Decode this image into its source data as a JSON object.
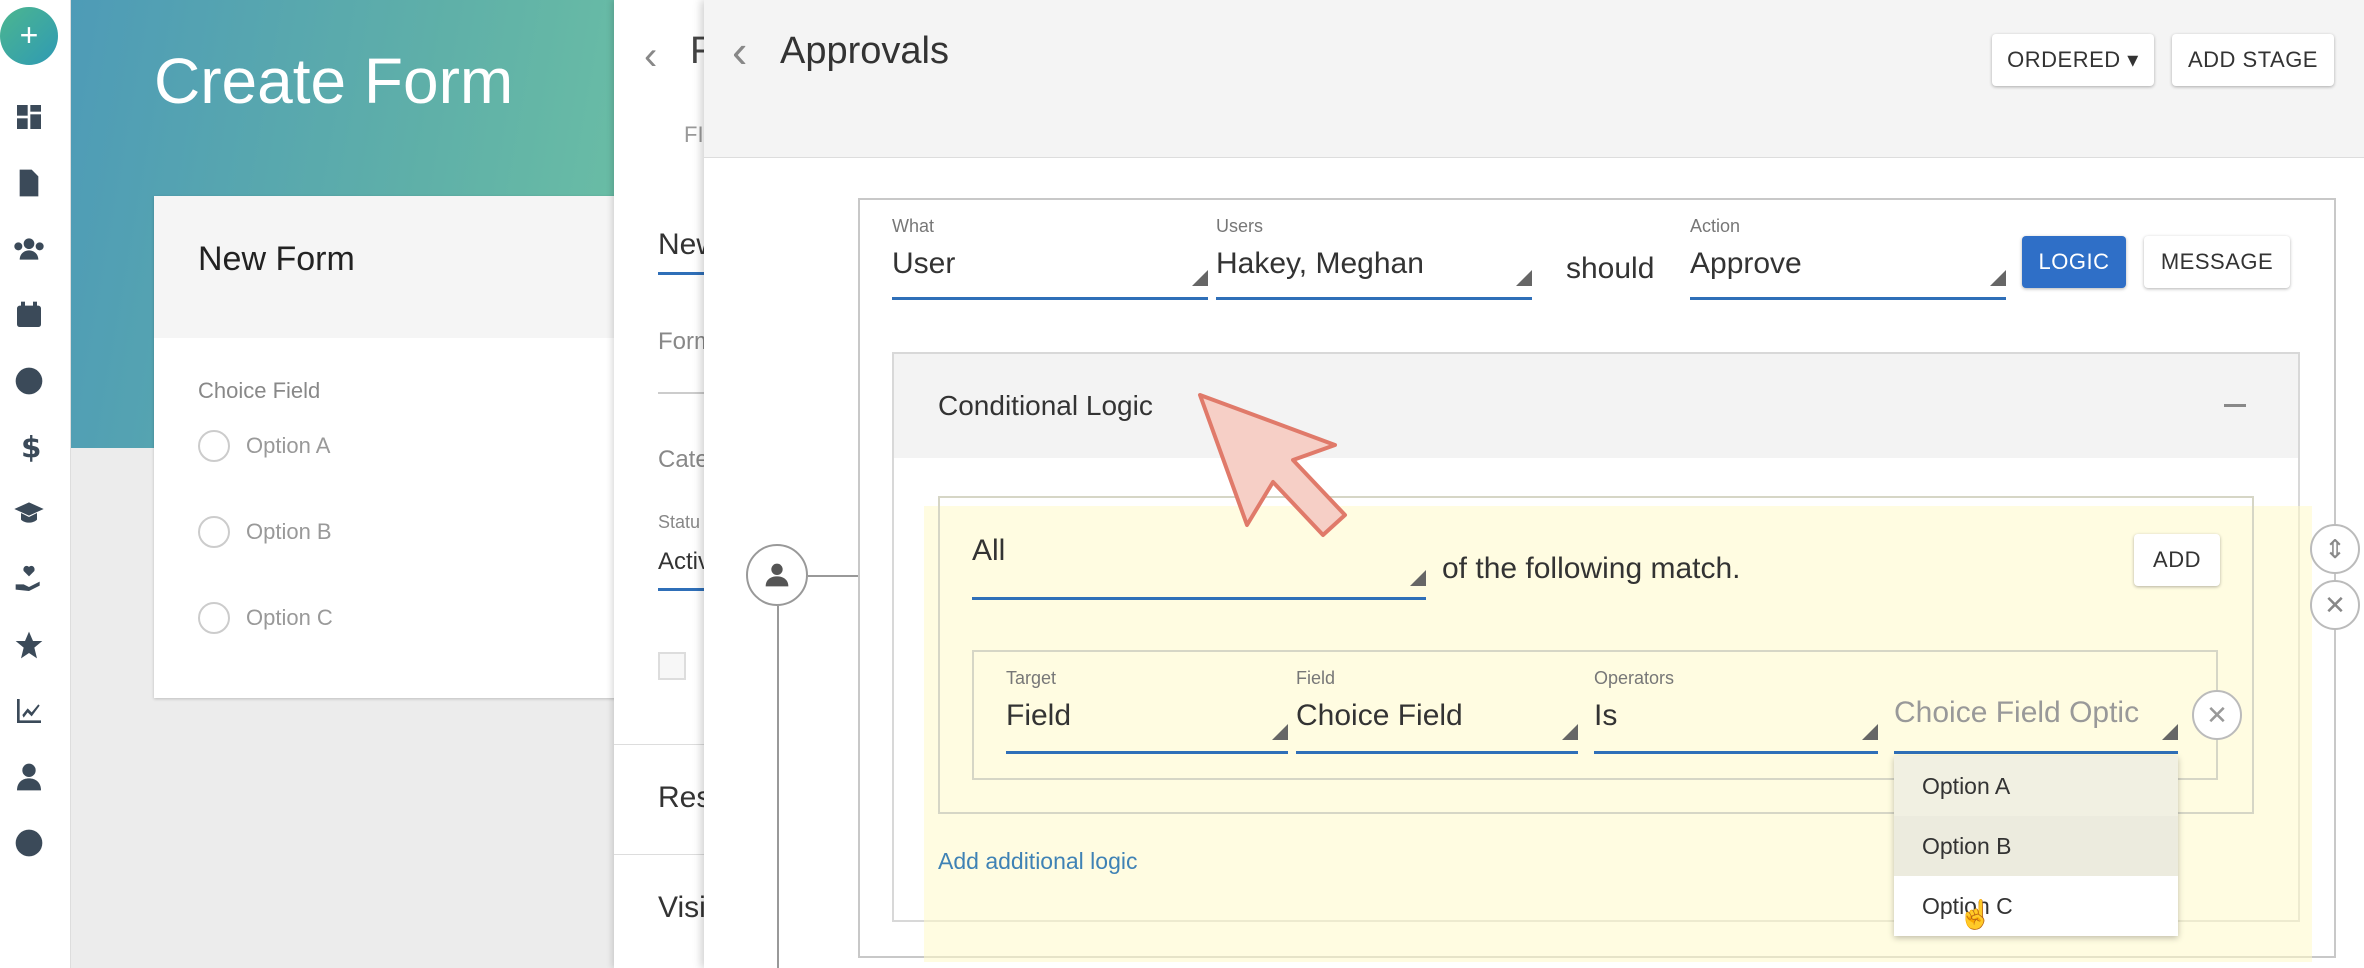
{
  "rail": {
    "fab_label": "+",
    "icons": [
      "dashboard-icon",
      "document-icon",
      "users-icon",
      "calendar-icon",
      "globe-icon",
      "dollar-icon",
      "graduation-icon",
      "hand-heart-icon",
      "star-icon",
      "chart-icon",
      "person-icon",
      "compass-icon"
    ]
  },
  "create_form": {
    "title": "Create Form",
    "card_title": "New Form",
    "field_label": "Choice Field",
    "options": [
      "Option A",
      "Option B",
      "Option C"
    ]
  },
  "middle_panel": {
    "title_fragment": "F",
    "tab_fragment": "FI",
    "heading_fragment": "New",
    "label_form_fragment": "Form",
    "label_category_fragment": "Cate",
    "label_status_fragment": "Statu",
    "status_value_fragment": "Activ",
    "section_res_fragment": "Res",
    "section_visi_fragment": "Visi"
  },
  "approvals": {
    "title": "Approvals",
    "ordered_label": "ORDERED ▾",
    "add_stage_label": "ADD STAGE",
    "what_caption": "What",
    "what_value": "User",
    "users_caption": "Users",
    "users_value": "Hakey, Meghan",
    "should_text": "should",
    "action_caption": "Action",
    "action_value": "Approve",
    "logic_label": "LOGIC",
    "message_label": "MESSAGE",
    "conditional_title": "Conditional Logic",
    "all_value": "All",
    "match_text": "of the following match.",
    "add_label": "ADD",
    "target_caption": "Target",
    "target_value": "Field",
    "field_caption": "Field",
    "field_value": "Choice Field",
    "operators_caption": "Operators",
    "operators_value": "Is",
    "choice_placeholder": "Choice Field Optic",
    "dropdown_options": [
      "Option A",
      "Option B",
      "Option C"
    ],
    "add_additional_logic": "Add additional logic"
  },
  "colors": {
    "accent": "#2f6fc7",
    "highlight": "#fffac8",
    "arrow_fill": "#f6cfc6",
    "arrow_stroke": "#e07a6a"
  }
}
